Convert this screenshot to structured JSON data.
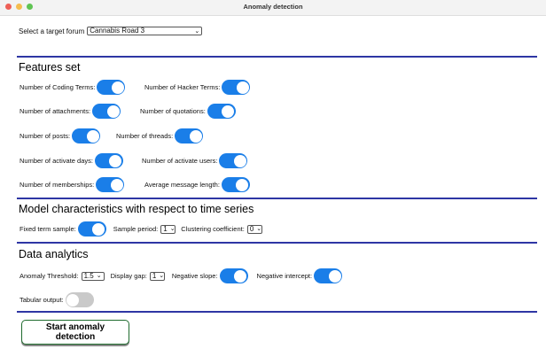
{
  "window": {
    "title": "Anomaly detection",
    "traffic_colors": [
      "#ee5f57",
      "#f5bd4f",
      "#5fc453"
    ]
  },
  "forum": {
    "label": "Select a target forum",
    "selected": "Cannabis Road 3"
  },
  "features": {
    "title": "Features set",
    "items": [
      {
        "label": "Number of Coding Terms:",
        "on": true
      },
      {
        "label": "Number of Hacker Terms:",
        "on": true
      },
      {
        "label": "Number of attachments:",
        "on": true
      },
      {
        "label": "Number of quotations:",
        "on": true
      },
      {
        "label": "Number of posts:",
        "on": true
      },
      {
        "label": "Number of threads:",
        "on": true
      },
      {
        "label": "Number of activate days:",
        "on": true
      },
      {
        "label": "Number of activate users:",
        "on": true
      },
      {
        "label": "Number of memberships:",
        "on": true
      },
      {
        "label": "Average message length:",
        "on": true
      }
    ]
  },
  "model": {
    "title": "Model characteristics with respect to time series",
    "fixed_term_label": "Fixed term sample:",
    "fixed_term_on": true,
    "sample_period_label": "Sample period:",
    "sample_period_value": "1",
    "clustering_label": "Clustering coefficient:",
    "clustering_value": "0"
  },
  "analytics": {
    "title": "Data analytics",
    "threshold_label": "Anomaly Threshold:",
    "threshold_value": "1.5",
    "display_gap_label": "Display gap:",
    "display_gap_value": "1",
    "neg_slope_label": "Negative slope:",
    "neg_slope_on": true,
    "neg_intercept_label": "Negative intercept:",
    "neg_intercept_on": true,
    "tabular_label": "Tabular output:",
    "tabular_on": false
  },
  "actions": {
    "start_label": "Start anomaly detection"
  },
  "colors": {
    "accent": "#1a7ee8",
    "rule": "#2e36a4",
    "button_border": "#1f6b2e"
  }
}
